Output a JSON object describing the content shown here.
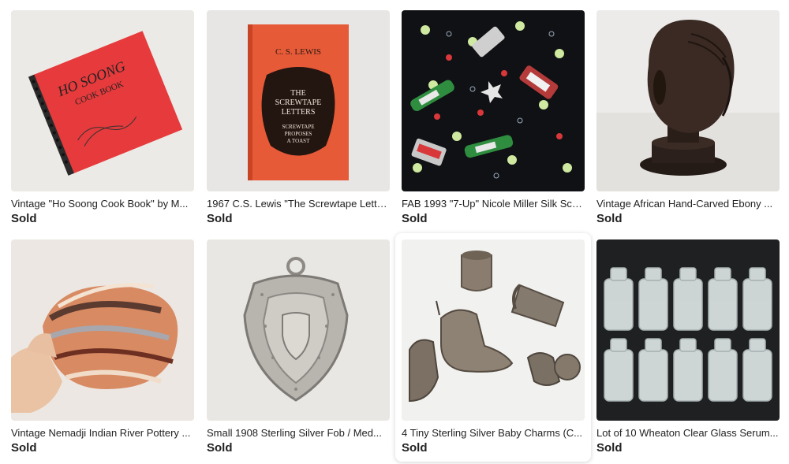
{
  "listings": [
    {
      "title": "Vintage \"Ho Soong Cook Book\" by M...",
      "status": "Sold",
      "image": "Red spiral-bound cookbook titled \"HO SOONG COOK BOOK\""
    },
    {
      "title": "1967 C.S. Lewis \"The Screwtape Lette...",
      "status": "Sold",
      "image": "Orange hardcover book \"C.S. LEWIS - THE SCREWTAPE LETTERS\""
    },
    {
      "title": "FAB 1993 \"7-Up\" Nicole Miller Silk Sca...",
      "status": "Sold",
      "image": "Black silk scarf printed with 7-Up bottles and cans"
    },
    {
      "title": "Vintage African Hand-Carved Ebony ...",
      "status": "Sold",
      "image": "Dark carved ebony head bust on round base"
    },
    {
      "title": "Vintage Nemadji Indian River Pottery ...",
      "status": "Sold",
      "image": "Swirled orange and gray Nemadji pottery bowl held in hand"
    },
    {
      "title": "Small 1908 Sterling Silver Fob / Med...",
      "status": "Sold",
      "image": "Ornate sterling silver shield-shaped watch fob"
    },
    {
      "title": "4 Tiny Sterling Silver Baby Charms (C...",
      "status": "Sold",
      "image": "Four small sterling silver baby charms: shoes, cup, cradle, rattle"
    },
    {
      "title": "Lot of 10 Wheaton Clear Glass Serum...",
      "status": "Sold",
      "image": "Ten clear glass serum bottles arranged in two rows"
    }
  ]
}
